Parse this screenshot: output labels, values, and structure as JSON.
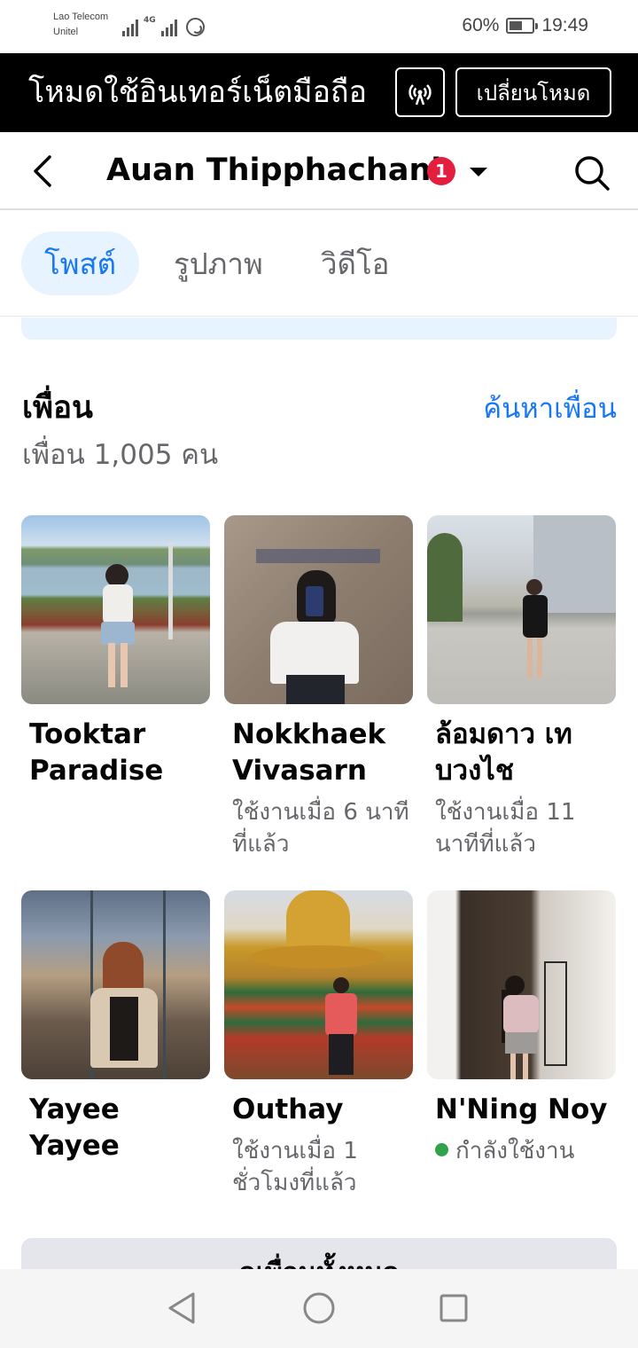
{
  "status_bar": {
    "carrier_line1": "Lao Telecom",
    "carrier_line2": "Unitel",
    "network_type": "4G",
    "battery_percent": "60%",
    "battery_level": 0.6,
    "time": "19:49",
    "icons": [
      "signal-icon",
      "signal-icon",
      "whatsapp-icon",
      "battery-icon"
    ]
  },
  "mode_banner": {
    "title": "โหมดใช้อินเทอร์เน็ตมือถือ",
    "icon": "mobile-data-icon",
    "switch_label": "เปลี่ยนโหมด"
  },
  "header": {
    "profile_name": "Auan Thipphachanh",
    "notification_count": "1",
    "icons": [
      "back-arrow-icon",
      "dropdown-caret-icon",
      "search-icon"
    ]
  },
  "tabs": [
    {
      "label": "โพสต์",
      "active": true
    },
    {
      "label": "รูปภาพ",
      "active": false
    },
    {
      "label": "วิดีโอ",
      "active": false
    }
  ],
  "friends": {
    "title": "เพื่อน",
    "find_link": "ค้นหาเพื่อน",
    "count_text": "เพื่อน 1,005 คน",
    "list": [
      {
        "name": "Tooktar Paradise",
        "status": ""
      },
      {
        "name": "Nokkhaek Vivasarn",
        "status": "ใช้งานเมื่อ 6 นาทีที่แล้ว"
      },
      {
        "name": "ล้อมดาว เทบวงไช",
        "status": "ใช้งานเมื่อ 11 นาทีที่แล้ว"
      },
      {
        "name": "Yayee Yayee",
        "status": ""
      },
      {
        "name": "Outhay",
        "status": "ใช้งานเมื่อ 1 ชั่วโมงที่แล้ว"
      },
      {
        "name": "N'Ning Noy",
        "status": "กำลังใช้งาน",
        "online": true
      }
    ],
    "see_all_label": "ดูเพื่อนทั้งหมด"
  },
  "colors": {
    "accent": "#1877f2",
    "tab_active_bg": "#e7f3ff",
    "badge": "#e41e3f",
    "online": "#31a24c",
    "secondary_text": "#65676b"
  },
  "nav_bar": {
    "icons": [
      "nav-back-icon",
      "nav-home-icon",
      "nav-recents-icon"
    ]
  }
}
